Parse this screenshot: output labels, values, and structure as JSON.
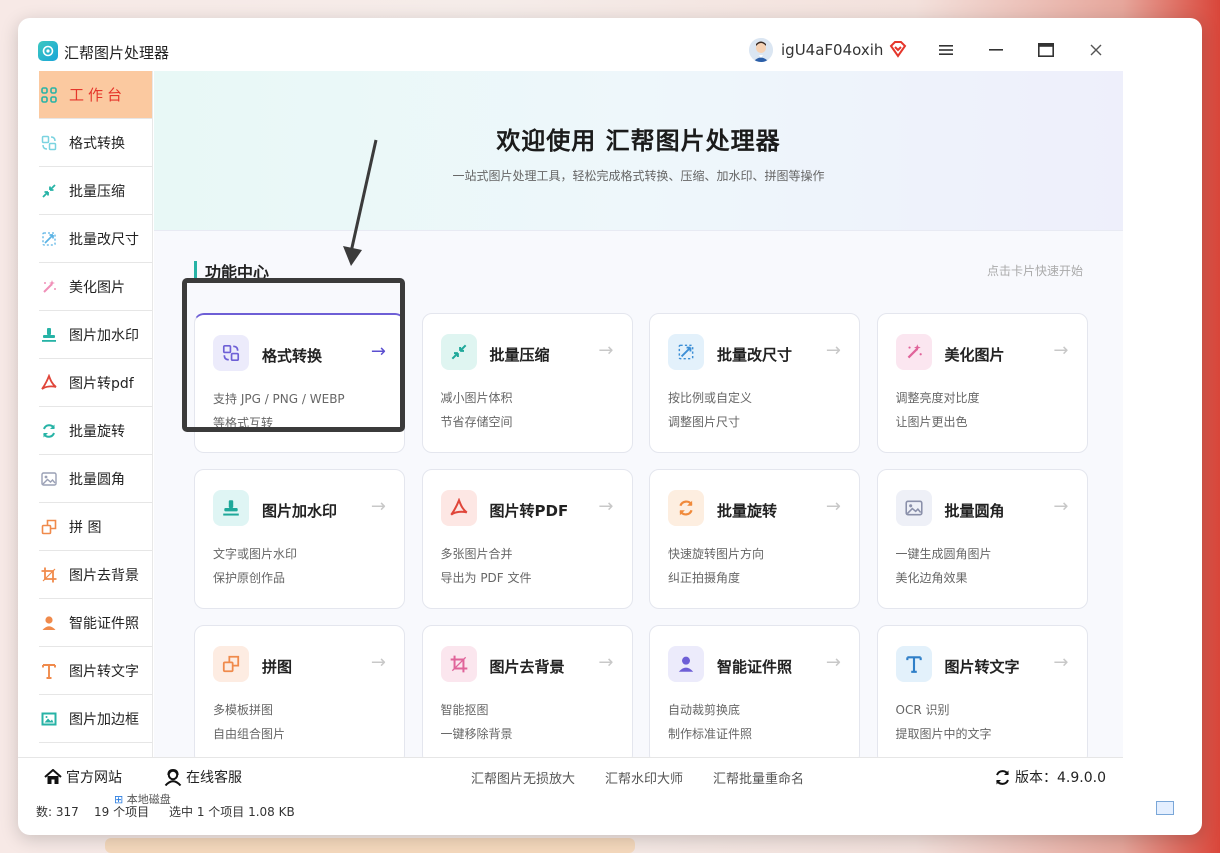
{
  "app": {
    "title": "汇帮图片处理器",
    "user": "igU4aF04oxih"
  },
  "sidebar": {
    "items": [
      {
        "label": "工作台",
        "icon": "grid-icon",
        "color": "#27b3a6",
        "active": true
      },
      {
        "label": "格式转换",
        "icon": "convert-icon",
        "color": "#7ad3e0"
      },
      {
        "label": "批量压缩",
        "icon": "compress-icon",
        "color": "#27b3a6"
      },
      {
        "label": "批量改尺寸",
        "icon": "resize-icon",
        "color": "#5ab3e5"
      },
      {
        "label": "美化图片",
        "icon": "magic-wand-icon",
        "color": "#f08fb8"
      },
      {
        "label": "图片加水印",
        "icon": "stamp-icon",
        "color": "#27b3a6"
      },
      {
        "label": "图片转pdf",
        "icon": "pdf-icon",
        "color": "#e0463a"
      },
      {
        "label": "批量旋转",
        "icon": "rotate-icon",
        "color": "#27b3a6"
      },
      {
        "label": "批量圆角",
        "icon": "image-icon",
        "color": "#9aa0b5"
      },
      {
        "label": "拼    图",
        "icon": "puzzle-icon",
        "color": "#f08a4b"
      },
      {
        "label": "图片去背景",
        "icon": "crop-icon",
        "color": "#f08a4b"
      },
      {
        "label": "智能证件照",
        "icon": "person-icon",
        "color": "#f08a4b"
      },
      {
        "label": "图片转文字",
        "icon": "text-icon",
        "color": "#f08a4b"
      },
      {
        "label": "图片加边框",
        "icon": "frame-icon",
        "color": "#27b3a6"
      }
    ]
  },
  "hero": {
    "title": "欢迎使用 汇帮图片处理器",
    "subtitle": "一站式图片处理工具，轻松完成格式转换、压缩、加水印、拼图等操作"
  },
  "section": {
    "title": "功能中心",
    "hint": "点击卡片快速开始"
  },
  "cards": [
    {
      "title": "格式转换",
      "d1": "支持 JPG / PNG / WEBP",
      "d2": "等格式互转",
      "icon": "convert-icon",
      "bg": "#ecebfb",
      "fg": "#6e5fd6",
      "arrow": "→"
    },
    {
      "title": "批量压缩",
      "d1": "减小图片体积",
      "d2": "节省存储空间",
      "icon": "compress-icon",
      "bg": "#dff5f1",
      "fg": "#1fa89a",
      "arrow": "→"
    },
    {
      "title": "批量改尺寸",
      "d1": "按比例或自定义",
      "d2": "调整图片尺寸",
      "icon": "resize-icon",
      "bg": "#e3f1fb",
      "fg": "#3d8fd6",
      "arrow": "→"
    },
    {
      "title": "美化图片",
      "d1": "调整亮度对比度",
      "d2": "让图片更出色",
      "icon": "magic-wand-icon",
      "bg": "#fbe6f0",
      "fg": "#e0649a",
      "arrow": "→"
    },
    {
      "title": "图片加水印",
      "d1": "文字或图片水印",
      "d2": "保护原创作品",
      "icon": "stamp-icon",
      "bg": "#dff5f4",
      "fg": "#1fa89a",
      "arrow": "→"
    },
    {
      "title": "图片转PDF",
      "d1": "多张图片合并",
      "d2": "导出为 PDF 文件",
      "icon": "pdf-icon",
      "bg": "#fde7e4",
      "fg": "#e0463a",
      "arrow": "→"
    },
    {
      "title": "批量旋转",
      "d1": "快速旋转图片方向",
      "d2": "纠正拍摄角度",
      "icon": "rotate-icon",
      "bg": "#fdeee0",
      "fg": "#f08a3b",
      "arrow": "→"
    },
    {
      "title": "批量圆角",
      "d1": "一键生成圆角图片",
      "d2": "美化边角效果",
      "icon": "image-icon",
      "bg": "#eef0f7",
      "fg": "#8a90aa",
      "arrow": "→"
    },
    {
      "title": "拼图",
      "d1": "多模板拼图",
      "d2": "自由组合图片",
      "icon": "puzzle-icon",
      "bg": "#fdece2",
      "fg": "#f08a4b",
      "arrow": "→"
    },
    {
      "title": "图片去背景",
      "d1": "智能抠图",
      "d2": "一键移除背景",
      "icon": "crop-icon",
      "bg": "#fbe6ee",
      "fg": "#e0649a",
      "arrow": "→"
    },
    {
      "title": "智能证件照",
      "d1": "自动裁剪换底",
      "d2": "制作标准证件照",
      "icon": "person-icon",
      "bg": "#ecebfb",
      "fg": "#6e5fd6",
      "arrow": "→"
    },
    {
      "title": "图片转文字",
      "d1": "OCR 识别",
      "d2": "提取图片中的文字",
      "icon": "text-icon",
      "bg": "#e3f1fb",
      "fg": "#2f7fc8",
      "arrow": "→"
    }
  ],
  "bottom": {
    "website": "官方网站",
    "support": "在线客服",
    "links": [
      "汇帮图片无损放大",
      "汇帮水印大师",
      "汇帮批量重命名"
    ],
    "version": "版本：4.9.0.0"
  },
  "status": {
    "s1": "数: 317",
    "s2": "19 个项目",
    "s3": "选中 1 个项目  1.08 KB",
    "s4": "本地磁盘"
  }
}
